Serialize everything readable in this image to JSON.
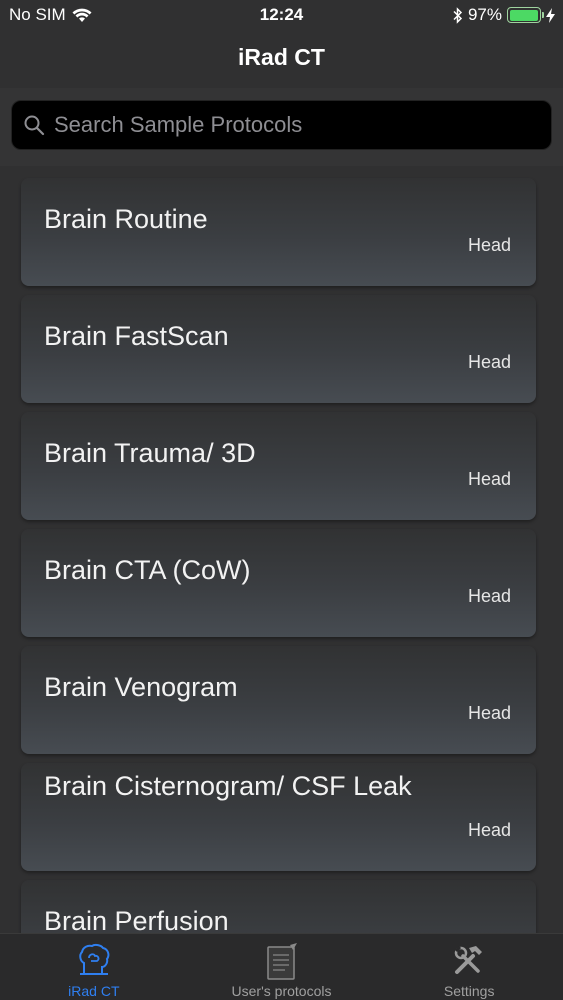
{
  "status": {
    "carrier": "No SIM",
    "time": "12:24",
    "battery_percent": "97%",
    "battery_level": 0.97
  },
  "nav": {
    "title": "iRad CT"
  },
  "search": {
    "placeholder": "Search Sample Protocols"
  },
  "protocols": [
    {
      "name": "Brain Routine",
      "tag": "Head"
    },
    {
      "name": "Brain FastScan",
      "tag": "Head"
    },
    {
      "name": "Brain Trauma/ 3D",
      "tag": "Head"
    },
    {
      "name": "Brain CTA (CoW)",
      "tag": "Head"
    },
    {
      "name": "Brain Venogram",
      "tag": "Head"
    },
    {
      "name": "Brain Cisternogram/ CSF Leak",
      "tag": "Head"
    },
    {
      "name": "Brain Perfusion",
      "tag": ""
    }
  ],
  "tabs": [
    {
      "label": "iRad CT",
      "icon": "brain-icon",
      "active": true
    },
    {
      "label": "User's protocols",
      "icon": "notepad-icon",
      "active": false
    },
    {
      "label": "Settings",
      "icon": "tools-icon",
      "active": false
    }
  ],
  "colors": {
    "accent": "#2f7ff0",
    "background": "#2e2e2f",
    "battery": "#4cd964"
  }
}
